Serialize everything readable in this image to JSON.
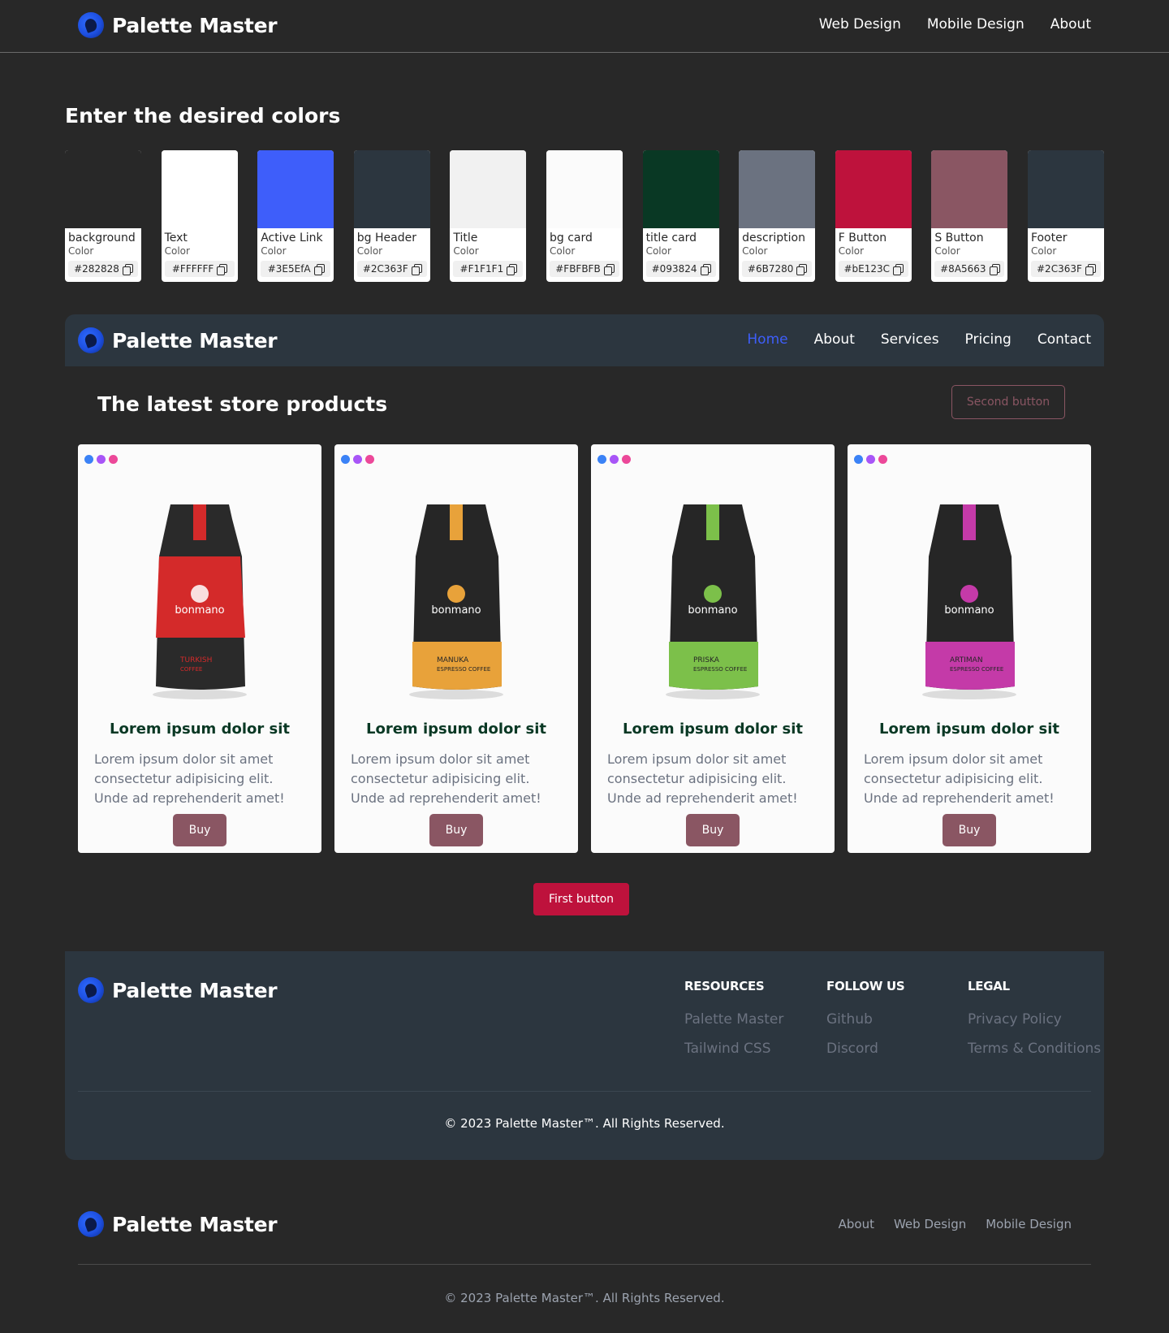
{
  "brand": {
    "name": "Palette Master"
  },
  "top_nav": {
    "links": [
      "Web Design",
      "Mobile Design",
      "About"
    ]
  },
  "heading": "Enter the desired colors",
  "swatches": [
    {
      "name": "background",
      "sub": "Color",
      "hex": "#282828",
      "color": "#282828"
    },
    {
      "name": "Text",
      "sub": "Color",
      "hex": "#FFFFFF",
      "color": "#FFFFFF"
    },
    {
      "name": "Active Link",
      "sub": "Color",
      "hex": "#3E5EfA",
      "color": "#3E5EFA"
    },
    {
      "name": "bg Header",
      "sub": "Color",
      "hex": "#2C363F",
      "color": "#2C363F"
    },
    {
      "name": "Title",
      "sub": "Color",
      "hex": "#F1F1F1",
      "color": "#F1F1F1"
    },
    {
      "name": "bg card",
      "sub": "Color",
      "hex": "#FBFBFB",
      "color": "#FBFBFB"
    },
    {
      "name": "title card",
      "sub": "Color",
      "hex": "#093824",
      "color": "#093824"
    },
    {
      "name": "description",
      "sub": "Color",
      "hex": "#6B7280",
      "color": "#6B7280"
    },
    {
      "name": "F Button",
      "sub": "Color",
      "hex": "#bE123C",
      "color": "#BE123C"
    },
    {
      "name": "S Button",
      "sub": "Color",
      "hex": "#8A5663",
      "color": "#8A5663"
    },
    {
      "name": "Footer",
      "sub": "Color",
      "hex": "#2C363F",
      "color": "#2C363F"
    }
  ],
  "preview": {
    "nav_links": [
      "Home",
      "About",
      "Services",
      "Pricing",
      "Contact"
    ],
    "active_link": "Home",
    "title": "The latest store products",
    "second_button": "Second button",
    "first_button": "First button",
    "cards": [
      {
        "title": "Lorem ipsum dolor sit",
        "description": "Lorem ipsum dolor sit amet consectetur adipisicing elit. Unde ad reprehenderit amet!",
        "button": "Buy",
        "accent": "#d42a2a",
        "pack_brand": "bonmano",
        "pack_label_1": "TURKISH",
        "pack_label_2": "COFFEE"
      },
      {
        "title": "Lorem ipsum dolor sit",
        "description": "Lorem ipsum dolor sit amet consectetur adipisicing elit. Unde ad reprehenderit amet!",
        "button": "Buy",
        "accent": "#e8a23a",
        "pack_brand": "bonmano",
        "pack_label_1": "MANUKA",
        "pack_label_2": "ESPRESSO COFFEE"
      },
      {
        "title": "Lorem ipsum dolor sit",
        "description": "Lorem ipsum dolor sit amet consectetur adipisicing elit. Unde ad reprehenderit amet!",
        "button": "Buy",
        "accent": "#7cc04a",
        "pack_brand": "bonmano",
        "pack_label_1": "PRISKA",
        "pack_label_2": "ESPRESSO COFFEE"
      },
      {
        "title": "Lorem ipsum dolor sit",
        "description": "Lorem ipsum dolor sit amet consectetur adipisicing elit. Unde ad reprehenderit amet!",
        "button": "Buy",
        "accent": "#c43aa8",
        "pack_brand": "bonmano",
        "pack_label_1": "ARTIMAN",
        "pack_label_2": "ESPRESSO COFFEE"
      }
    ],
    "card_dot_colors": [
      "#3b82f6",
      "#a855f7",
      "#ec4899"
    ],
    "footer": {
      "columns": [
        {
          "heading": "RESOURCES",
          "links": [
            "Palette Master",
            "Tailwind CSS"
          ]
        },
        {
          "heading": "FOLLOW US",
          "links": [
            "Github",
            "Discord"
          ]
        },
        {
          "heading": "LEGAL",
          "links": [
            "Privacy Policy",
            "Terms & Conditions"
          ]
        }
      ],
      "copyright": "© 2023 Palette Master™. All Rights Reserved."
    }
  },
  "site_footer": {
    "links": [
      "About",
      "Web Design",
      "Mobile Design"
    ],
    "copyright": "© 2023 Palette Master™. All Rights Reserved."
  }
}
